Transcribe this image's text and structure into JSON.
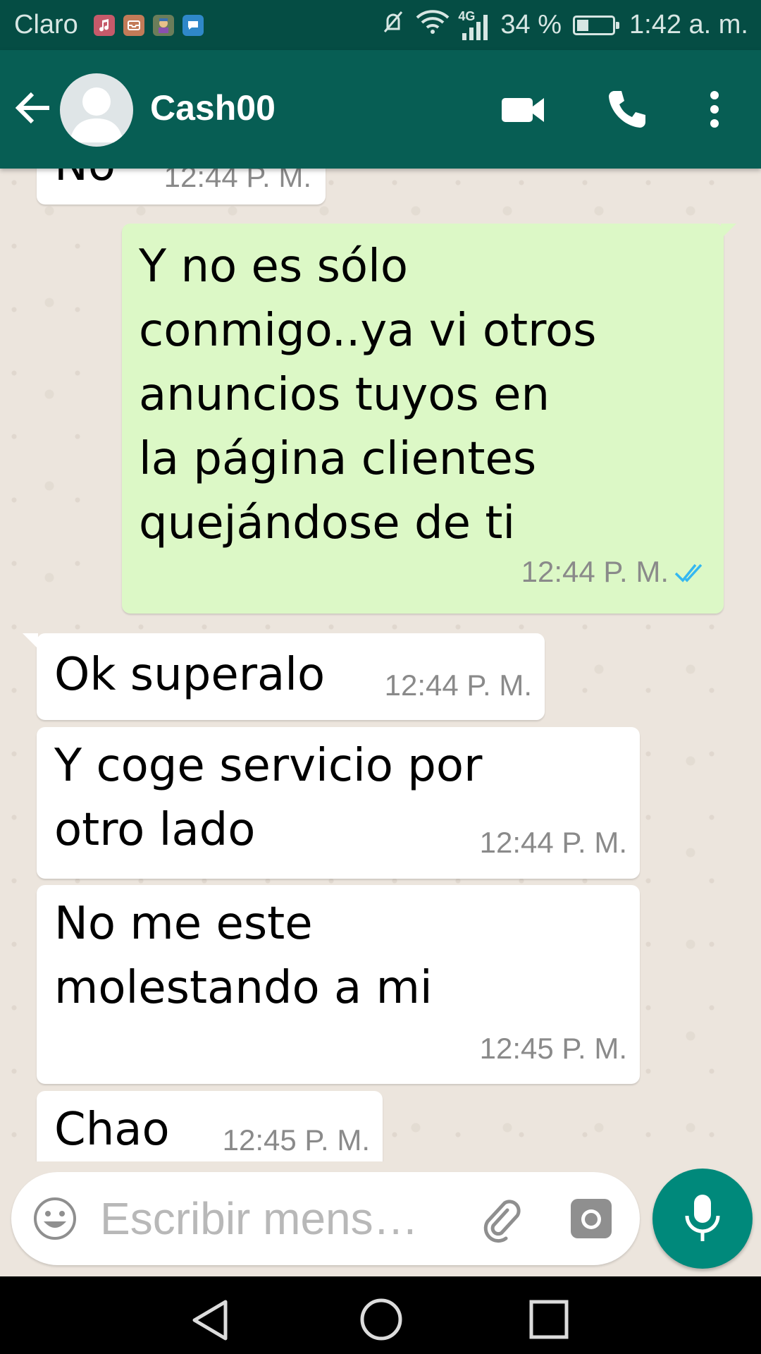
{
  "status_bar": {
    "carrier": "Claro",
    "network": "4G",
    "battery": "34 %",
    "battery_level": 0.34,
    "time": "1:42 a. m.",
    "notification_icons": [
      "music-app-icon",
      "mail-app-icon",
      "game-app-icon",
      "messenger-app-icon"
    ]
  },
  "header": {
    "contact_name": "Cash00",
    "icons": [
      "back-arrow-icon",
      "video-call-icon",
      "phone-icon",
      "more-vert-icon"
    ]
  },
  "messages": [
    {
      "direction": "in",
      "text": "No",
      "time": "12:44 P. M."
    },
    {
      "direction": "out",
      "text": "Y no es sólo\nconmigo..ya vi otros\nanuncios tuyos en\nla página clientes\nquejándose de ti",
      "time": "12:44 P. M.",
      "status": "read"
    },
    {
      "direction": "in",
      "text": "Ok superalo",
      "time": "12:44 P. M."
    },
    {
      "direction": "in",
      "text": "Y coge servicio por\notro lado",
      "time": "12:44 P. M."
    },
    {
      "direction": "in",
      "text": "No me este\nmolestando a mi",
      "time": "12:45 P. M."
    },
    {
      "direction": "in",
      "text": "Chao",
      "time": "12:45 P. M."
    }
  ],
  "composer": {
    "placeholder": "Escribir mens…",
    "value": ""
  },
  "colors": {
    "status_bar": "#054d44",
    "header": "#075e54",
    "chat_background": "#ece5dd",
    "outgoing_bubble": "#dcf8c6",
    "incoming_bubble": "#ffffff",
    "read_ticks": "#34b7f1",
    "mic_button": "#00897b"
  }
}
